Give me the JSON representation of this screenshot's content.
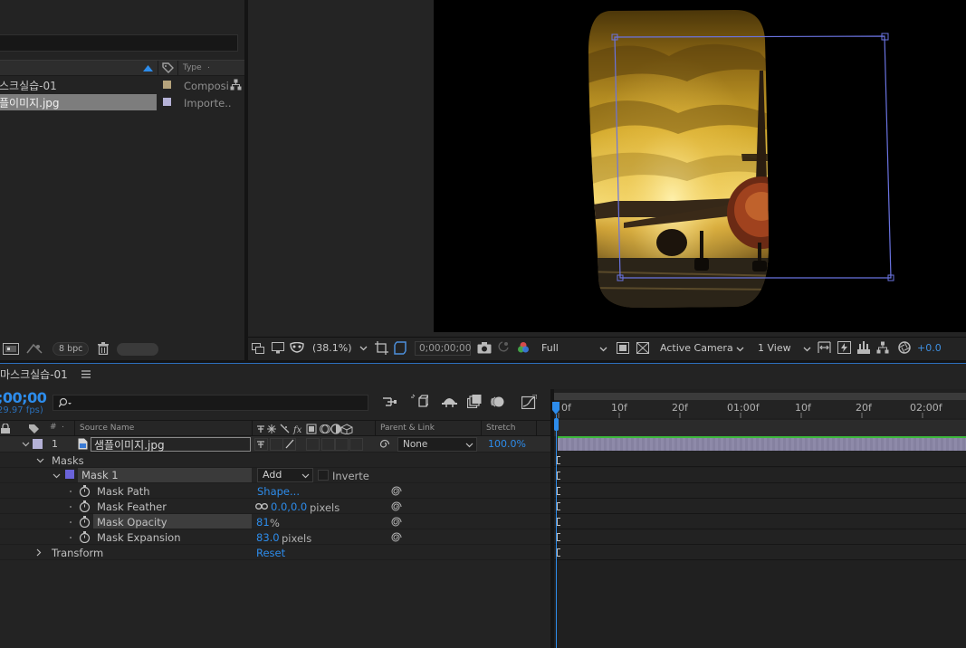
{
  "project": {
    "col_type": "Type",
    "col_type_dot": ".",
    "items": [
      {
        "name": "스크실습-01",
        "type": "Composi",
        "swatch": "#b5a37c",
        "selected": false
      },
      {
        "name": "플이미지.jpg",
        "type": "Importe..",
        "swatch": "#b5b2d7",
        "selected": true
      }
    ],
    "bpc": "8 bpc"
  },
  "viewer": {
    "zoom": "(38.1%)",
    "timecode": "0;00;00;00",
    "resolution": "Full",
    "camera": "Active Camera",
    "views": "1 View",
    "exposure": "+0.0"
  },
  "timeline": {
    "comp_tab": "마스크실습-01",
    "timecode": ";00;00",
    "fps": "29.97 fps)",
    "cols": {
      "hash": "#",
      "dot": ".",
      "source": "Source Name",
      "parent": "Parent & Link",
      "stretch": "Stretch"
    },
    "layer": {
      "num": "1",
      "name": "샘플이미지.jpg",
      "parent": "None",
      "stretch": "100.0%"
    },
    "masks_label": "Masks",
    "mask": {
      "name": "Mask 1",
      "mode": "Add",
      "inverted": "Inverte",
      "color": "#6a63d9",
      "path_label": "Mask Path",
      "path_value": "Shape...",
      "feather_label": "Mask Feather",
      "feather_value": "0.0,0.0",
      "feather_unit": "pixels",
      "opacity_label": "Mask Opacity",
      "opacity_value": "81",
      "opacity_unit": "%",
      "expansion_label": "Mask Expansion",
      "expansion_value": "83.0",
      "expansion_unit": "pixels"
    },
    "transform_label": "Transform",
    "transform_value": "Reset",
    "ruler": [
      "0f",
      "10f",
      "20f",
      "01:00f",
      "10f",
      "20f",
      "02:00f"
    ]
  }
}
